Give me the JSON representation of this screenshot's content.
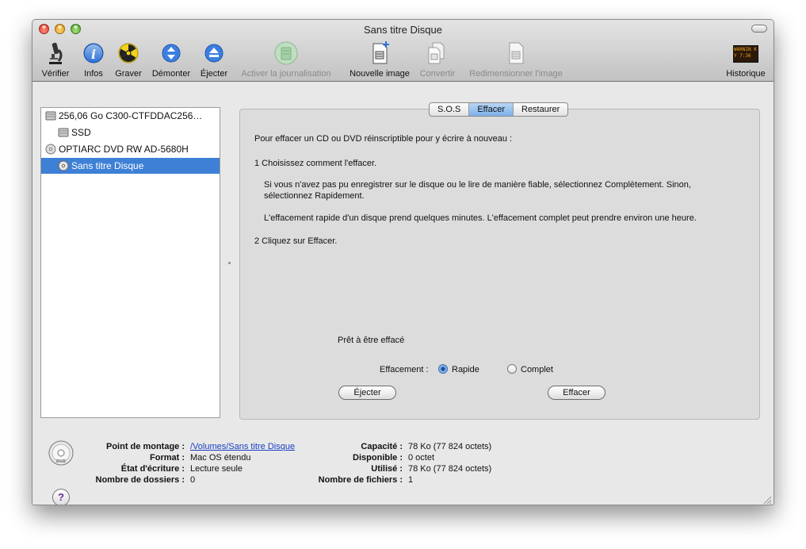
{
  "window": {
    "title": "Sans titre Disque"
  },
  "toolbar": {
    "verify": "Vérifier",
    "info": "Infos",
    "burn": "Graver",
    "unmount": "Démonter",
    "eject": "Éjecter",
    "journaling": "Activer la journalisation",
    "new_image": "Nouvelle image",
    "convert": "Convertir",
    "resize": "Redimensionner l'image",
    "history": "Historique",
    "history_icon_text": "WARNIN KY 7:36"
  },
  "sidebar": {
    "items": [
      {
        "label": "256,06 Go C300-CTFDDAC256…",
        "icon": "hard-drive-icon"
      },
      {
        "label": "SSD",
        "icon": "volume-icon"
      },
      {
        "label": "OPTIARC DVD RW AD-5680H",
        "icon": "optical-drive-icon"
      },
      {
        "label": "Sans titre Disque",
        "icon": "disc-icon",
        "selected": true
      }
    ]
  },
  "tabs": {
    "sos": "S.O.S",
    "erase": "Effacer",
    "restore": "Restaurer"
  },
  "erase": {
    "intro": "Pour effacer un CD ou DVD réinscriptible pour y écrire à nouveau :",
    "step1": "1  Choisissez comment l'effacer.",
    "para1_line1": "Si vous n'avez pas pu enregistrer sur le disque ou le lire de manière fiable, sélectionnez Complètement. Sinon,",
    "para1_line2": "sélectionnez Rapidement.",
    "para2": "L'effacement rapide d'un disque prend quelques minutes. L'effacement complet peut prendre environ une heure.",
    "step2": "2  Cliquez sur Effacer.",
    "status": "Prêt à être effacé",
    "mode_label": "Effacement :",
    "option_quick": "Rapide",
    "option_complete": "Complet",
    "selected_option": "Rapide",
    "eject_button": "Éjecter",
    "erase_button": "Effacer"
  },
  "info": {
    "mount_point_label": "Point de montage :",
    "mount_point_value": "/Volumes/Sans titre Disque",
    "format_label": "Format :",
    "format_value": "Mac OS étendu",
    "write_state_label": "État d'écriture :",
    "write_state_value": "Lecture seule",
    "folders_label": "Nombre de dossiers :",
    "folders_value": "0",
    "capacity_label": "Capacité :",
    "capacity_value": "78 Ko (77 824 octets)",
    "available_label": "Disponible :",
    "available_value": "0 octet",
    "used_label": "Utilisé :",
    "used_value": "78 Ko (77 824 octets)",
    "files_label": "Nombre de fichiers :",
    "files_value": "1",
    "help": "?"
  }
}
